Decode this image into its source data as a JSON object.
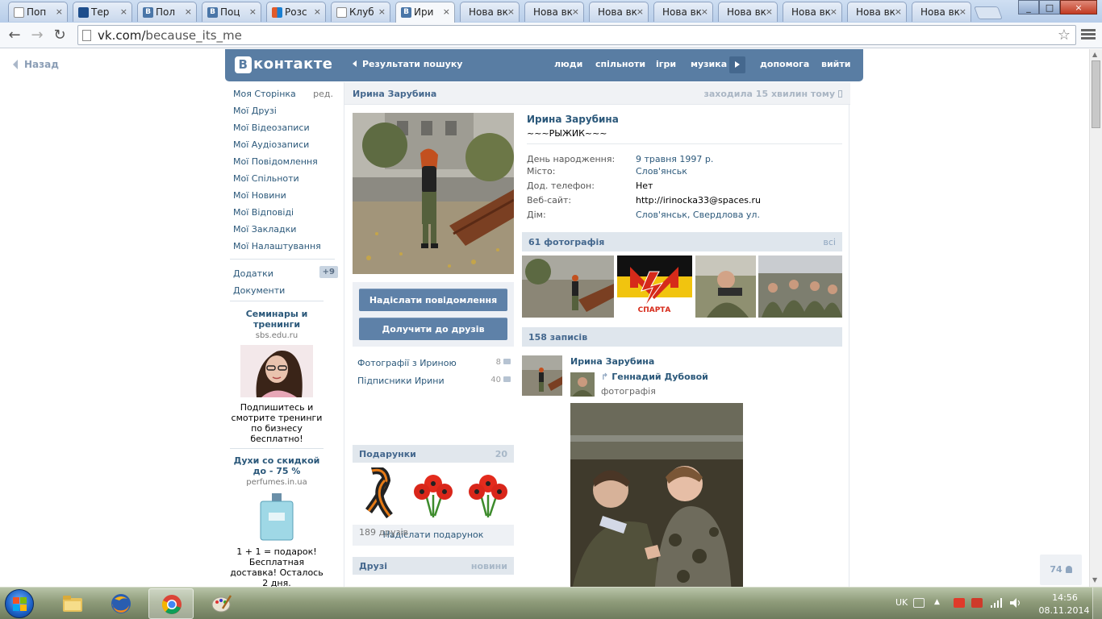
{
  "browser": {
    "tabs": [
      {
        "label": "Поп",
        "icon": "doc"
      },
      {
        "label": "Тер",
        "icon": "ir"
      },
      {
        "label": "Пол",
        "icon": "vk"
      },
      {
        "label": "Поц",
        "icon": "vk"
      },
      {
        "label": "Розс",
        "icon": "ms"
      },
      {
        "label": "Клуб",
        "icon": "doc"
      },
      {
        "label": "Ири",
        "icon": "vk"
      },
      {
        "label": "Нова вк",
        "icon": "none"
      },
      {
        "label": "Нова вк",
        "icon": "none"
      },
      {
        "label": "Нова вк",
        "icon": "none"
      },
      {
        "label": "Нова вк",
        "icon": "none"
      },
      {
        "label": "Нова вк",
        "icon": "none"
      },
      {
        "label": "Нова вк",
        "icon": "none"
      },
      {
        "label": "Нова вк",
        "icon": "none"
      },
      {
        "label": "Нова вк",
        "icon": "none"
      }
    ],
    "tab_close": "×",
    "url_host": "vk.com/",
    "url_path": "because_its_me",
    "back_icon": "←",
    "forward_icon": "→",
    "reload_icon": "↻",
    "star_icon": "☆",
    "win_min": "_",
    "win_max": "□",
    "win_close": "×"
  },
  "page": {
    "back_link": "Назад",
    "header": {
      "logo_letter": "В",
      "logo_text": "контакте",
      "search_results": "Результати пошуку",
      "nav": [
        "люди",
        "спільноти",
        "ігри",
        "музика",
        "допомога",
        "вийти"
      ]
    },
    "left_menu": {
      "items": [
        "Моя Сторінка",
        "Мої Друзі",
        "Мої Відеозаписи",
        "Мої Аудіозаписи",
        "Мої Повідомлення",
        "Мої Спільноти",
        "Мої Новини",
        "Мої Відповіді",
        "Мої Закладки",
        "Мої Налаштування"
      ],
      "edit_label": "ред.",
      "apps": "Додатки",
      "apps_badge": "+9",
      "docs": "Документи"
    },
    "ads": [
      {
        "title": "Семинары и тренинги",
        "domain": "sbs.edu.ru",
        "text": "Подпишитесь и смотрите тренинги по бизнесу бесплатно!"
      },
      {
        "title": "Духи со скидкой до - 75 %",
        "domain": "perfumes.in.ua",
        "text": "1 + 1 = подарок! Бесплатная доставка! Осталось 2 дня."
      }
    ],
    "profile": {
      "name": "Ирина Зарубина",
      "last_seen": "заходила 15 хвилин тому",
      "status": "~~~РЫЖИК~~~",
      "info": [
        {
          "label": "День народження:",
          "value": "9 травня 1997 р.",
          "link": true
        },
        {
          "label": "Місто:",
          "value": "Слов'янськ",
          "link": true
        },
        {
          "label": "Дод. телефон:",
          "value": "Нет",
          "link": false
        },
        {
          "label": "Веб-сайт:",
          "value": "http://irinocka33@spaces.ru",
          "link": false
        },
        {
          "label": "Дім:",
          "value": "Слов'янськ, Свердлова ул.",
          "link": true
        }
      ],
      "send_message": "Надіслати повідомлення",
      "add_friend": "Долучити до друзів",
      "photos_with": {
        "label": "Фотографії з Ириною",
        "count": "8"
      },
      "followers": {
        "label": "Підписники Ирини",
        "count": "40"
      },
      "gifts": {
        "title": "Подарунки",
        "count": "20"
      },
      "send_gift": "Надіслати подарунок",
      "friends": {
        "title": "Друзі",
        "new_link": "новини",
        "count": "189 друзів"
      },
      "photos_section": {
        "title": "61 фотографія",
        "all": "всі"
      },
      "photo_sparta_label": "СПАРТА",
      "wall": {
        "title": "158 записів"
      },
      "post": {
        "author": "Ирина Зарубина",
        "repost_name": "Геннадий Дубовой",
        "repost_type": "фотографія",
        "repost_icon": "↱"
      }
    },
    "float_counter": "74"
  },
  "taskbar": {
    "lang": "UK",
    "time": "14:56",
    "date": "08.11.2014"
  },
  "colors": {
    "vk_blue": "#597da3",
    "link": "#2b587a",
    "button": "#5e81a8"
  }
}
